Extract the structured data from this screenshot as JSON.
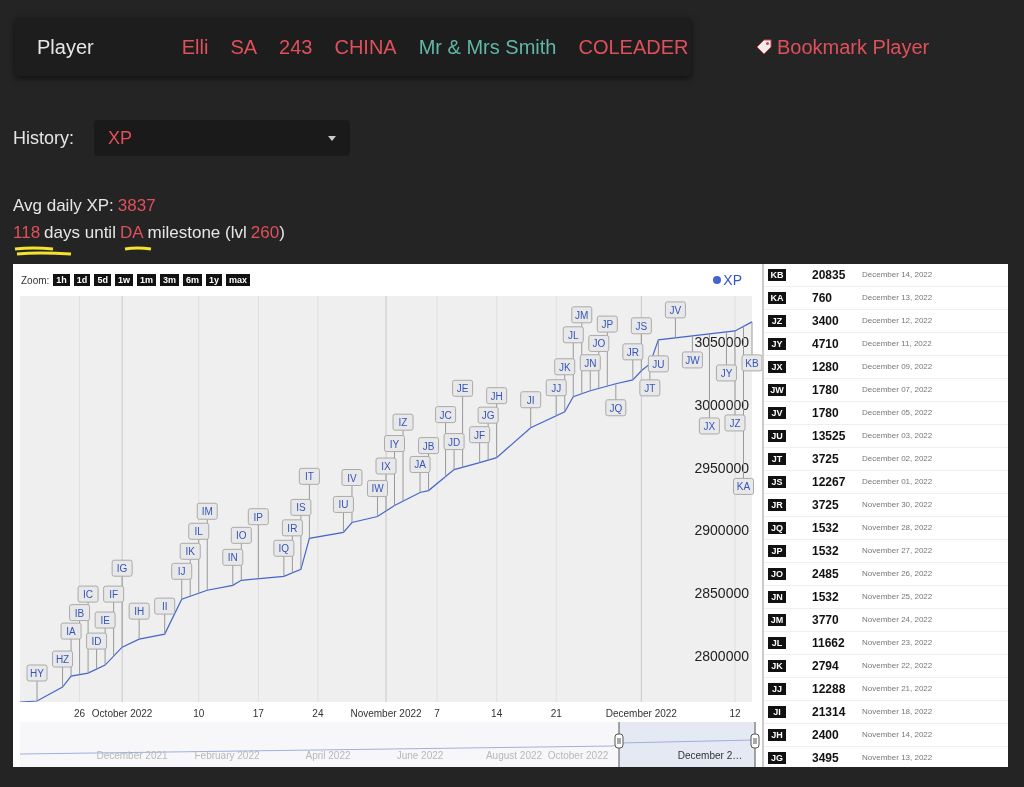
{
  "player_bar": {
    "label": "Player",
    "fields": [
      {
        "text": "Elli",
        "color": "#e0505a"
      },
      {
        "text": "SA",
        "color": "#e0505a"
      },
      {
        "text": "243",
        "color": "#e0505a"
      },
      {
        "text": "CHINA",
        "color": "#e0505a"
      },
      {
        "text": "Mr & Mrs Smith",
        "color": "#5fb8a8"
      },
      {
        "text": "COLEADER",
        "color": "#e0505a"
      }
    ]
  },
  "bookmark": {
    "label": "Bookmark Player"
  },
  "history": {
    "label": "History:",
    "value": "XP"
  },
  "avg": {
    "label": "Avg daily XP:",
    "value": "3837"
  },
  "countdown": {
    "days": "118",
    "text1": "days until",
    "target": "DA",
    "text2": "milestone (lvl",
    "level": "260",
    "text3": ")"
  },
  "zoom": {
    "label": "Zoom:",
    "buttons": [
      "1h",
      "1d",
      "5d",
      "1w",
      "1m",
      "3m",
      "6m",
      "1y",
      "max"
    ]
  },
  "chart_data": {
    "type": "line",
    "grid": true,
    "xlim": [
      "2022-09-19",
      "2022-12-14"
    ],
    "ylim": [
      2763500,
      3086500
    ],
    "xticks": [
      {
        "value": "2022-09-26",
        "label": "26"
      },
      {
        "value": "2022-10-01",
        "label": "October 2022"
      },
      {
        "value": "2022-10-10",
        "label": "10"
      },
      {
        "value": "2022-10-17",
        "label": "17"
      },
      {
        "value": "2022-10-24",
        "label": "24"
      },
      {
        "value": "2022-11-01",
        "label": "November 2022"
      },
      {
        "value": "2022-11-07",
        "label": "7"
      },
      {
        "value": "2022-11-14",
        "label": "14"
      },
      {
        "value": "2022-11-21",
        "label": "21"
      },
      {
        "value": "2022-12-01",
        "label": "December 2022"
      },
      {
        "value": "2022-12-12",
        "label": "12"
      }
    ],
    "yticks": [
      2800000,
      2850000,
      2900000,
      2950000,
      3000000,
      3050000
    ],
    "x": [
      "2022-09-19",
      "2022-09-21",
      "2022-09-24",
      "2022-09-25",
      "2022-09-27",
      "2022-09-29",
      "2022-10-01",
      "2022-10-03",
      "2022-10-06",
      "2022-10-08",
      "2022-10-10",
      "2022-10-11",
      "2022-10-14",
      "2022-10-15",
      "2022-10-20",
      "2022-10-22",
      "2022-10-23",
      "2022-10-27",
      "2022-10-28",
      "2022-10-31",
      "2022-11-02",
      "2022-11-05",
      "2022-11-06",
      "2022-11-09",
      "2022-11-12",
      "2022-11-14",
      "2022-11-18",
      "2022-11-22",
      "2022-11-23",
      "2022-11-25",
      "2022-11-28",
      "2022-11-30",
      "2022-12-01",
      "2022-12-02",
      "2022-12-03",
      "2022-12-09",
      "2022-12-12",
      "2022-12-14"
    ],
    "series": [
      {
        "name": "XP",
        "color": "#4466cc",
        "values": [
          2763500,
          2764300,
          2775400,
          2784100,
          2786500,
          2792900,
          2807100,
          2813500,
          2817500,
          2845200,
          2850000,
          2852400,
          2856300,
          2860300,
          2863500,
          2869000,
          2893700,
          2898400,
          2906300,
          2911100,
          2919800,
          2930200,
          2931700,
          2948400,
          2953900,
          2957900,
          2981700,
          2994400,
          3006300,
          3011100,
          3016700,
          3019800,
          3027000,
          3032500,
          3051600,
          3056300,
          3058700,
          3065900
        ]
      }
    ],
    "annotations": [
      {
        "x": "2022-09-21",
        "text": "HY"
      },
      {
        "x": "2022-09-24",
        "text": "HZ"
      },
      {
        "x": "2022-09-25",
        "text": "IA"
      },
      {
        "x": "2022-09-26",
        "text": "IB"
      },
      {
        "x": "2022-09-27",
        "text": "IC"
      },
      {
        "x": "2022-09-28",
        "text": "ID"
      },
      {
        "x": "2022-09-29",
        "text": "IE"
      },
      {
        "x": "2022-09-30",
        "text": "IF"
      },
      {
        "x": "2022-10-01",
        "text": "IG"
      },
      {
        "x": "2022-10-03",
        "text": "IH"
      },
      {
        "x": "2022-10-06",
        "text": "II"
      },
      {
        "x": "2022-10-08",
        "text": "IJ"
      },
      {
        "x": "2022-10-09",
        "text": "IK"
      },
      {
        "x": "2022-10-10",
        "text": "IL"
      },
      {
        "x": "2022-10-11",
        "text": "IM"
      },
      {
        "x": "2022-10-14",
        "text": "IN"
      },
      {
        "x": "2022-10-15",
        "text": "IO"
      },
      {
        "x": "2022-10-17",
        "text": "IP"
      },
      {
        "x": "2022-10-20",
        "text": "IQ"
      },
      {
        "x": "2022-10-21",
        "text": "IR"
      },
      {
        "x": "2022-10-22",
        "text": "IS"
      },
      {
        "x": "2022-10-23",
        "text": "IT"
      },
      {
        "x": "2022-10-27",
        "text": "IU"
      },
      {
        "x": "2022-10-28",
        "text": "IV"
      },
      {
        "x": "2022-10-31",
        "text": "IW"
      },
      {
        "x": "2022-11-01",
        "text": "IX"
      },
      {
        "x": "2022-11-02",
        "text": "IY"
      },
      {
        "x": "2022-11-03",
        "text": "IZ"
      },
      {
        "x": "2022-11-05",
        "text": "JA"
      },
      {
        "x": "2022-11-06",
        "text": "JB"
      },
      {
        "x": "2022-11-08",
        "text": "JC"
      },
      {
        "x": "2022-11-09",
        "text": "JD"
      },
      {
        "x": "2022-11-10",
        "text": "JE"
      },
      {
        "x": "2022-11-12",
        "text": "JF"
      },
      {
        "x": "2022-11-13",
        "text": "JG"
      },
      {
        "x": "2022-11-14",
        "text": "JH"
      },
      {
        "x": "2022-11-18",
        "text": "JI"
      },
      {
        "x": "2022-11-21",
        "text": "JJ"
      },
      {
        "x": "2022-11-22",
        "text": "JK"
      },
      {
        "x": "2022-11-23",
        "text": "JL"
      },
      {
        "x": "2022-11-24",
        "text": "JM"
      },
      {
        "x": "2022-11-25",
        "text": "JN"
      },
      {
        "x": "2022-11-26",
        "text": "JO"
      },
      {
        "x": "2022-11-27",
        "text": "JP"
      },
      {
        "x": "2022-11-28",
        "text": "JQ"
      },
      {
        "x": "2022-11-30",
        "text": "JR"
      },
      {
        "x": "2022-12-01",
        "text": "JS"
      },
      {
        "x": "2022-12-02",
        "text": "JT"
      },
      {
        "x": "2022-12-03",
        "text": "JU"
      },
      {
        "x": "2022-12-05",
        "text": "JV"
      },
      {
        "x": "2022-12-07",
        "text": "JW"
      },
      {
        "x": "2022-12-09",
        "text": "JX"
      },
      {
        "x": "2022-12-11",
        "text": "JY"
      },
      {
        "x": "2022-12-12",
        "text": "JZ"
      },
      {
        "x": "2022-12-13",
        "text": "KA"
      },
      {
        "x": "2022-12-14",
        "text": "KB"
      }
    ]
  },
  "navigator_labels": [
    {
      "text": "December 2021",
      "selected": false
    },
    {
      "text": "February 2022",
      "selected": false
    },
    {
      "text": "April 2022",
      "selected": false
    },
    {
      "text": "June 2022",
      "selected": false
    },
    {
      "text": "August 2022",
      "selected": false
    },
    {
      "text": "October 2022",
      "selected": false
    },
    {
      "text": "December 2…",
      "selected": true
    }
  ],
  "entries": [
    {
      "tag": "KB",
      "value": "20835",
      "date": "December 14, 2022"
    },
    {
      "tag": "KA",
      "value": "760",
      "date": "December 13, 2022"
    },
    {
      "tag": "JZ",
      "value": "3400",
      "date": "December 12, 2022"
    },
    {
      "tag": "JY",
      "value": "4710",
      "date": "December 11, 2022"
    },
    {
      "tag": "JX",
      "value": "1280",
      "date": "December 09, 2022"
    },
    {
      "tag": "JW",
      "value": "1780",
      "date": "December 07, 2022"
    },
    {
      "tag": "JV",
      "value": "1780",
      "date": "December 05, 2022"
    },
    {
      "tag": "JU",
      "value": "13525",
      "date": "December 03, 2022"
    },
    {
      "tag": "JT",
      "value": "3725",
      "date": "December 02, 2022"
    },
    {
      "tag": "JS",
      "value": "12267",
      "date": "December 01, 2022"
    },
    {
      "tag": "JR",
      "value": "3725",
      "date": "November 30, 2022"
    },
    {
      "tag": "JQ",
      "value": "1532",
      "date": "November 28, 2022"
    },
    {
      "tag": "JP",
      "value": "1532",
      "date": "November 27, 2022"
    },
    {
      "tag": "JO",
      "value": "2485",
      "date": "November 26, 2022"
    },
    {
      "tag": "JN",
      "value": "1532",
      "date": "November 25, 2022"
    },
    {
      "tag": "JM",
      "value": "3770",
      "date": "November 24, 2022"
    },
    {
      "tag": "JL",
      "value": "11662",
      "date": "November 23, 2022"
    },
    {
      "tag": "JK",
      "value": "2794",
      "date": "November 22, 2022"
    },
    {
      "tag": "JJ",
      "value": "12288",
      "date": "November 21, 2022"
    },
    {
      "tag": "JI",
      "value": "21314",
      "date": "November 18, 2022"
    },
    {
      "tag": "JH",
      "value": "2400",
      "date": "November 14, 2022"
    },
    {
      "tag": "JG",
      "value": "3495",
      "date": "November 13, 2022"
    }
  ]
}
